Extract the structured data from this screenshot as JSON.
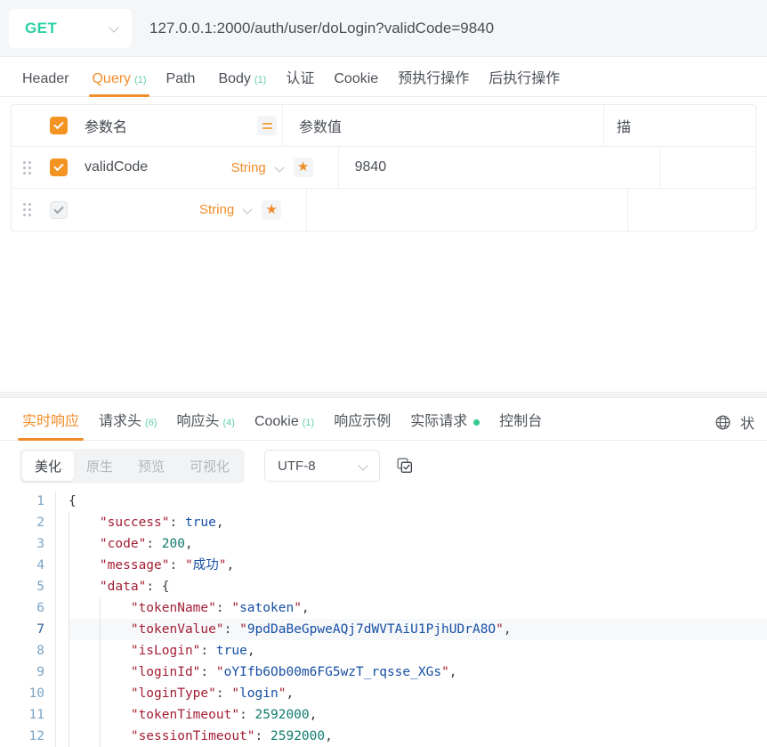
{
  "request": {
    "method": "GET",
    "method_dropdown_icon": "chevron-down-icon",
    "url": "127.0.0.1:2000/auth/user/doLogin?validCode=9840",
    "tabs": [
      {
        "label": "Header",
        "count": "",
        "active": false
      },
      {
        "label": "Query",
        "count": "(1)",
        "active": true
      },
      {
        "label": "Path",
        "count": "",
        "active": false
      },
      {
        "label": "Body",
        "count": "(1)",
        "active": false
      },
      {
        "label": "认证",
        "count": "",
        "active": false
      },
      {
        "label": "Cookie",
        "count": "",
        "active": false
      },
      {
        "label": "预执行操作",
        "count": "",
        "active": false
      },
      {
        "label": "后执行操作",
        "count": "",
        "active": false
      }
    ]
  },
  "param_table": {
    "header": {
      "checkbox_state": "checked",
      "name_col": "参数名",
      "equals_icon": "equals-icon",
      "value_col": "参数值",
      "desc_col": "描"
    },
    "rows": [
      {
        "drag_icon": "drag-handle-icon",
        "checkbox_state": "checked",
        "name": "validCode",
        "type": "String",
        "type_dropdown_icon": "chevron-down-icon",
        "required_icon": "★",
        "value": "9840",
        "desc": ""
      },
      {
        "drag_icon": "drag-handle-icon",
        "checkbox_state": "unchecked",
        "name": "",
        "type": "String",
        "type_dropdown_icon": "chevron-down-icon",
        "required_icon": "★",
        "value": "",
        "desc": ""
      }
    ]
  },
  "response": {
    "tabs": [
      {
        "label": "实时响应",
        "count": "",
        "active": true,
        "dot": false
      },
      {
        "label": "请求头",
        "count": "(6)",
        "active": false,
        "dot": false
      },
      {
        "label": "响应头",
        "count": "(4)",
        "active": false,
        "dot": false
      },
      {
        "label": "Cookie",
        "count": "(1)",
        "active": false,
        "dot": false
      },
      {
        "label": "响应示例",
        "count": "",
        "active": false,
        "dot": false
      },
      {
        "label": "实际请求",
        "count": "",
        "active": false,
        "dot": true
      },
      {
        "label": "控制台",
        "count": "",
        "active": false,
        "dot": false
      }
    ],
    "globe_icon": "globe-icon",
    "status_label": "状",
    "toolbar": {
      "segments": [
        {
          "label": "美化",
          "active": true
        },
        {
          "label": "原生",
          "active": false
        },
        {
          "label": "预览",
          "active": false
        },
        {
          "label": "可视化",
          "active": false
        }
      ],
      "encoding": "UTF-8",
      "encoding_dropdown_icon": "chevron-down-icon",
      "copy_icon": "copy-check-icon"
    },
    "body": {
      "line_numbers": [
        "1",
        "2",
        "3",
        "4",
        "5",
        "6",
        "7",
        "8",
        "9",
        "10",
        "11",
        "12"
      ],
      "current_line": 7,
      "lines": [
        [
          {
            "t": "{",
            "c": "p"
          }
        ],
        [
          {
            "t": "    ",
            "c": "p"
          },
          {
            "t": "\"success\"",
            "c": "k"
          },
          {
            "t": ": ",
            "c": "p"
          },
          {
            "t": "true",
            "c": "b"
          },
          {
            "t": ",",
            "c": "p"
          }
        ],
        [
          {
            "t": "    ",
            "c": "p"
          },
          {
            "t": "\"code\"",
            "c": "k"
          },
          {
            "t": ": ",
            "c": "p"
          },
          {
            "t": "200",
            "c": "n"
          },
          {
            "t": ",",
            "c": "p"
          }
        ],
        [
          {
            "t": "    ",
            "c": "p"
          },
          {
            "t": "\"message\"",
            "c": "k"
          },
          {
            "t": ": ",
            "c": "p"
          },
          {
            "t": "\"",
            "c": "sq"
          },
          {
            "t": "成功",
            "c": "s"
          },
          {
            "t": "\"",
            "c": "sq"
          },
          {
            "t": ",",
            "c": "p"
          }
        ],
        [
          {
            "t": "    ",
            "c": "p"
          },
          {
            "t": "\"data\"",
            "c": "k"
          },
          {
            "t": ": {",
            "c": "p"
          }
        ],
        [
          {
            "t": "        ",
            "c": "p"
          },
          {
            "t": "\"tokenName\"",
            "c": "k"
          },
          {
            "t": ": ",
            "c": "p"
          },
          {
            "t": "\"",
            "c": "sq"
          },
          {
            "t": "satoken",
            "c": "s"
          },
          {
            "t": "\"",
            "c": "sq"
          },
          {
            "t": ",",
            "c": "p"
          }
        ],
        [
          {
            "t": "        ",
            "c": "p"
          },
          {
            "t": "\"tokenValue\"",
            "c": "k"
          },
          {
            "t": ": ",
            "c": "p"
          },
          {
            "t": "\"",
            "c": "sq"
          },
          {
            "t": "9pdDaBeGpweAQj7dWVTAiU1PjhUDrA8O",
            "c": "s"
          },
          {
            "t": "\"",
            "c": "sq"
          },
          {
            "t": ",",
            "c": "p"
          }
        ],
        [
          {
            "t": "        ",
            "c": "p"
          },
          {
            "t": "\"isLogin\"",
            "c": "k"
          },
          {
            "t": ": ",
            "c": "p"
          },
          {
            "t": "true",
            "c": "b"
          },
          {
            "t": ",",
            "c": "p"
          }
        ],
        [
          {
            "t": "        ",
            "c": "p"
          },
          {
            "t": "\"loginId\"",
            "c": "k"
          },
          {
            "t": ": ",
            "c": "p"
          },
          {
            "t": "\"",
            "c": "sq"
          },
          {
            "t": "oYIfb6Ob00m6FG5wzT_rqsse_XGs",
            "c": "s"
          },
          {
            "t": "\"",
            "c": "sq"
          },
          {
            "t": ",",
            "c": "p"
          }
        ],
        [
          {
            "t": "        ",
            "c": "p"
          },
          {
            "t": "\"loginType\"",
            "c": "k"
          },
          {
            "t": ": ",
            "c": "p"
          },
          {
            "t": "\"",
            "c": "sq"
          },
          {
            "t": "login",
            "c": "s"
          },
          {
            "t": "\"",
            "c": "sq"
          },
          {
            "t": ",",
            "c": "p"
          }
        ],
        [
          {
            "t": "        ",
            "c": "p"
          },
          {
            "t": "\"tokenTimeout\"",
            "c": "k"
          },
          {
            "t": ": ",
            "c": "p"
          },
          {
            "t": "2592000",
            "c": "n"
          },
          {
            "t": ",",
            "c": "p"
          }
        ],
        [
          {
            "t": "        ",
            "c": "p"
          },
          {
            "t": "\"sessionTimeout\"",
            "c": "k"
          },
          {
            "t": ": ",
            "c": "p"
          },
          {
            "t": "2592000",
            "c": "n"
          },
          {
            "t": ",",
            "c": "p"
          }
        ]
      ]
    }
  },
  "colors": {
    "accent_orange": "#f28c28",
    "method_green": "#2ad0a5",
    "count_green": "#5fcfa8",
    "checkbox_on": "#f39422"
  }
}
